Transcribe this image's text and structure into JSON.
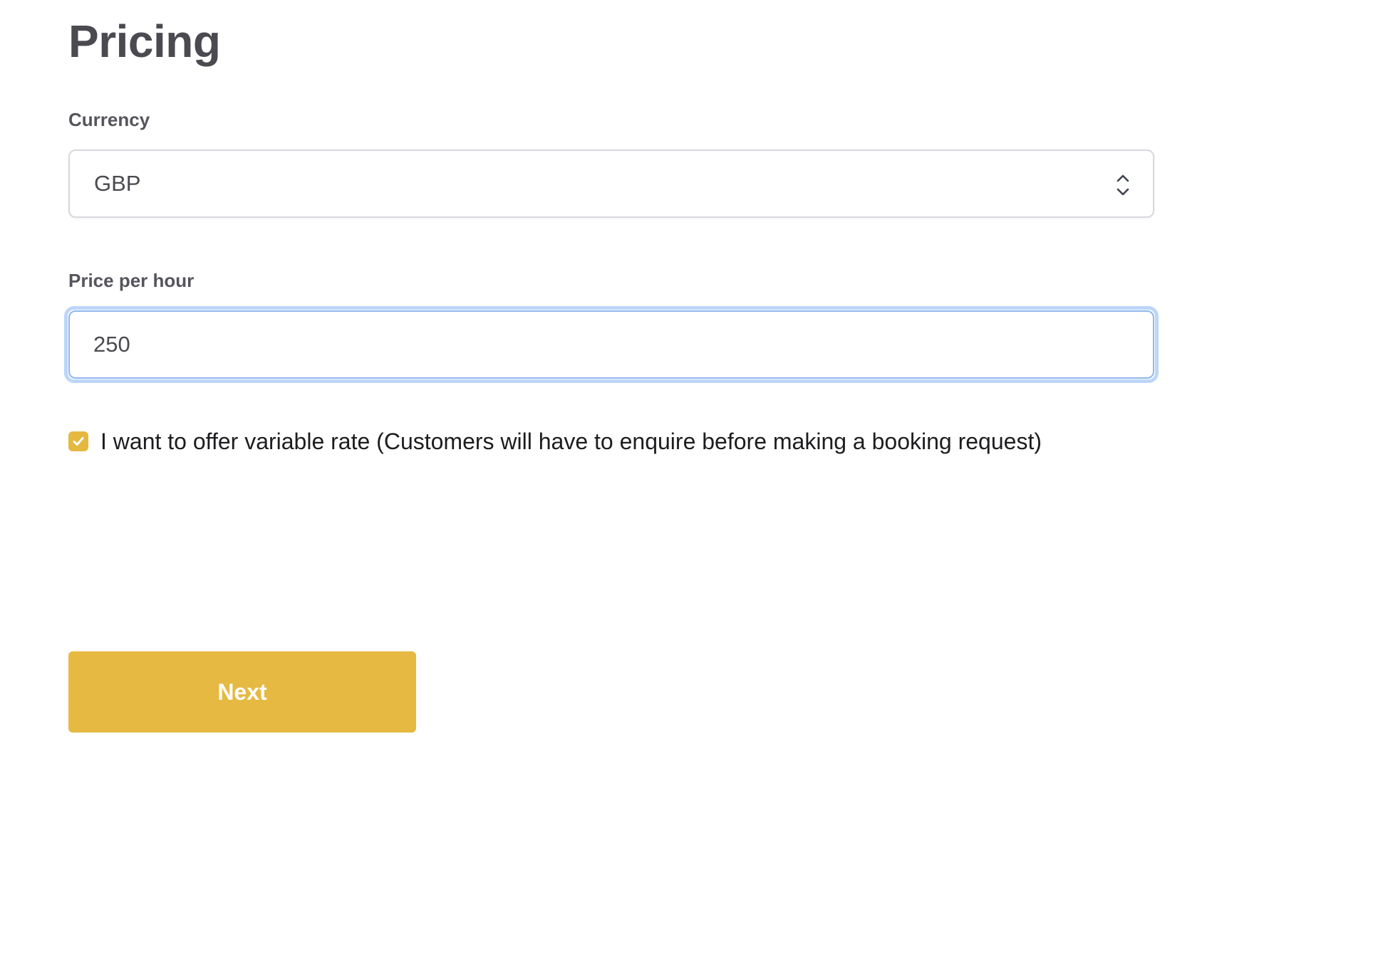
{
  "page": {
    "title": "Pricing"
  },
  "currency": {
    "label": "Currency",
    "selected": "GBP",
    "icon": "chevron-updown-icon"
  },
  "price": {
    "label": "Price per hour",
    "value": "250"
  },
  "variable_rate": {
    "checked": true,
    "label": "I want to offer variable rate (Customers will have to enquire before making a booking request)",
    "icon": "checkmark-icon"
  },
  "actions": {
    "next_label": "Next"
  },
  "colors": {
    "accent": "#E6B942",
    "focus_ring": "#BCD6FB",
    "text_heading": "#4A4A50",
    "text_body": "#1D1D20"
  }
}
